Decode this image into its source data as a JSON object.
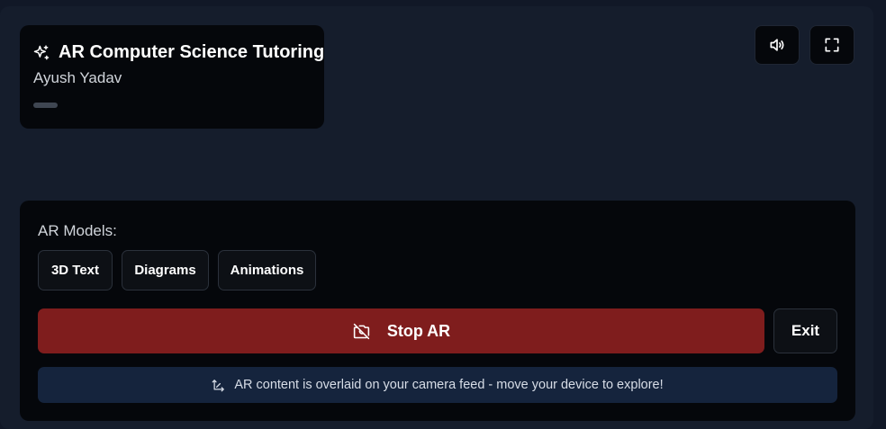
{
  "header": {
    "title": "AR Computer Science Tutoring",
    "title_icon": "sparkles-icon",
    "author": "Ayush Yadav",
    "progress_fraction": 0.0
  },
  "controls": {
    "sound_icon": "volume-icon",
    "fullscreen_icon": "fullscreen-icon"
  },
  "panel": {
    "models_label": "AR Models:",
    "models": [
      {
        "label": "3D Text"
      },
      {
        "label": "Diagrams"
      },
      {
        "label": "Animations"
      }
    ],
    "stop_label": "Stop AR",
    "stop_icon": "camera-off-icon",
    "exit_label": "Exit",
    "info_icon": "move-arrows-icon",
    "info_text": "AR content is overlaid on your camera feed - move your device to explore!"
  },
  "colors": {
    "background": "#111827",
    "card": "#05070b",
    "danger": "#7f1d1d",
    "info": "#15243d"
  }
}
